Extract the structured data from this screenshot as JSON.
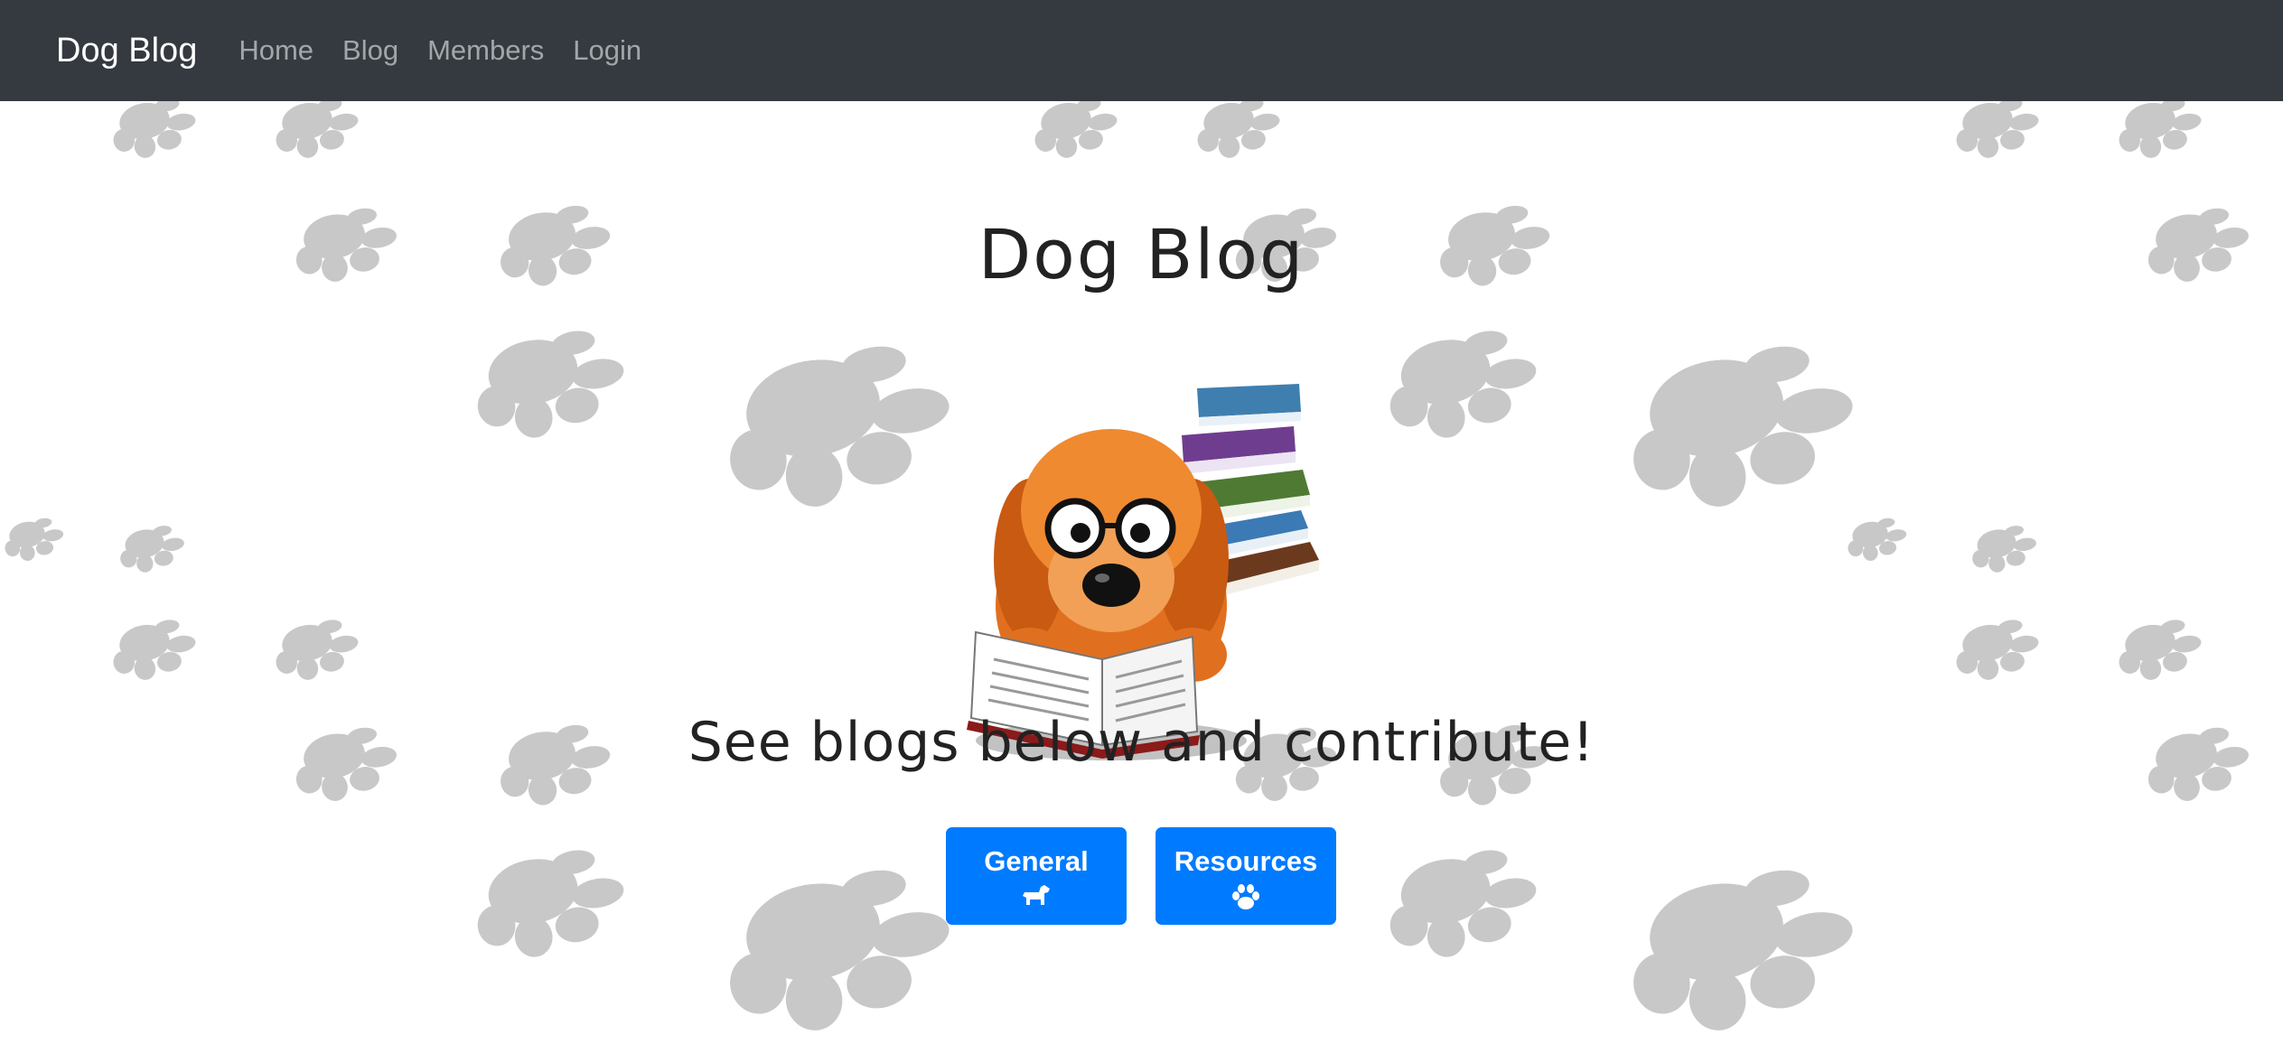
{
  "navbar": {
    "brand": "Dog Blog",
    "links": [
      {
        "label": "Home"
      },
      {
        "label": "Blog"
      },
      {
        "label": "Members"
      },
      {
        "label": "Login"
      }
    ]
  },
  "hero": {
    "title": "Dog Blog",
    "subtitle": "See blogs below and contribute!",
    "image": "dog-reading-book-with-glasses-icon"
  },
  "buttons": {
    "general": {
      "label": "General",
      "icon": "dog-icon"
    },
    "resources": {
      "label": "Resources",
      "icon": "paw-icon"
    }
  },
  "colors": {
    "navbar_bg": "#343a40",
    "button_bg": "#007bff",
    "paw_color": "#c8c8c8"
  }
}
